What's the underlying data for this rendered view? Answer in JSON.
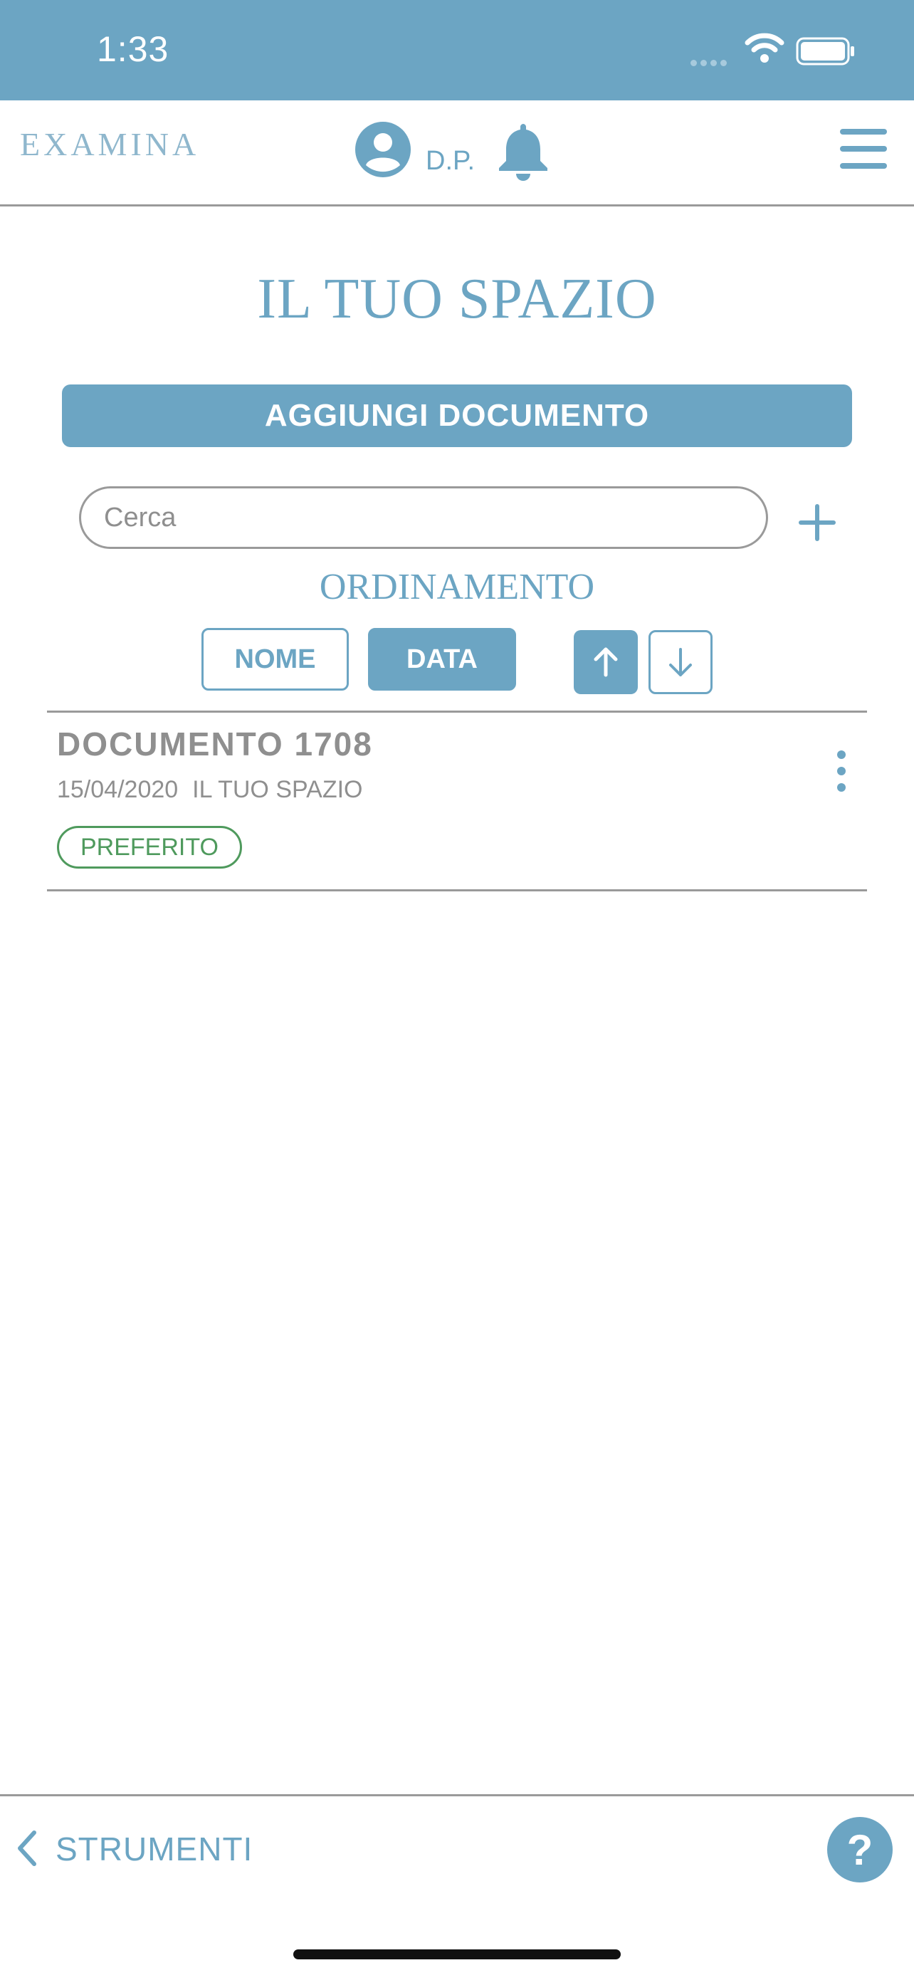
{
  "status_bar": {
    "time": "1:33"
  },
  "header": {
    "logo": "EXAMINA",
    "user_initials": "D.P.",
    "icons": [
      "user-icon",
      "bell-icon",
      "menu-icon"
    ]
  },
  "page": {
    "title": "IL TUO SPAZIO",
    "add_document_label": "AGGIUNGI DOCUMENTO"
  },
  "search": {
    "placeholder": "Cerca",
    "value": ""
  },
  "sorting": {
    "label": "ORDINAMENTO",
    "options": [
      {
        "label": "NOME",
        "selected": false
      },
      {
        "label": "DATA",
        "selected": true
      }
    ],
    "direction_ascending_selected": true
  },
  "documents": [
    {
      "title": "DOCUMENTO 1708",
      "date": "15/04/2020",
      "location": "IL TUO SPAZIO",
      "badge": "PREFERITO"
    }
  ],
  "footer": {
    "back_label": "STRUMENTI",
    "help_label": "?"
  },
  "colors": {
    "primary": "#6ca5c3",
    "favorite": "#4f9a5d",
    "muted_text": "#8f8f8f",
    "divider": "#9a9a9a"
  }
}
